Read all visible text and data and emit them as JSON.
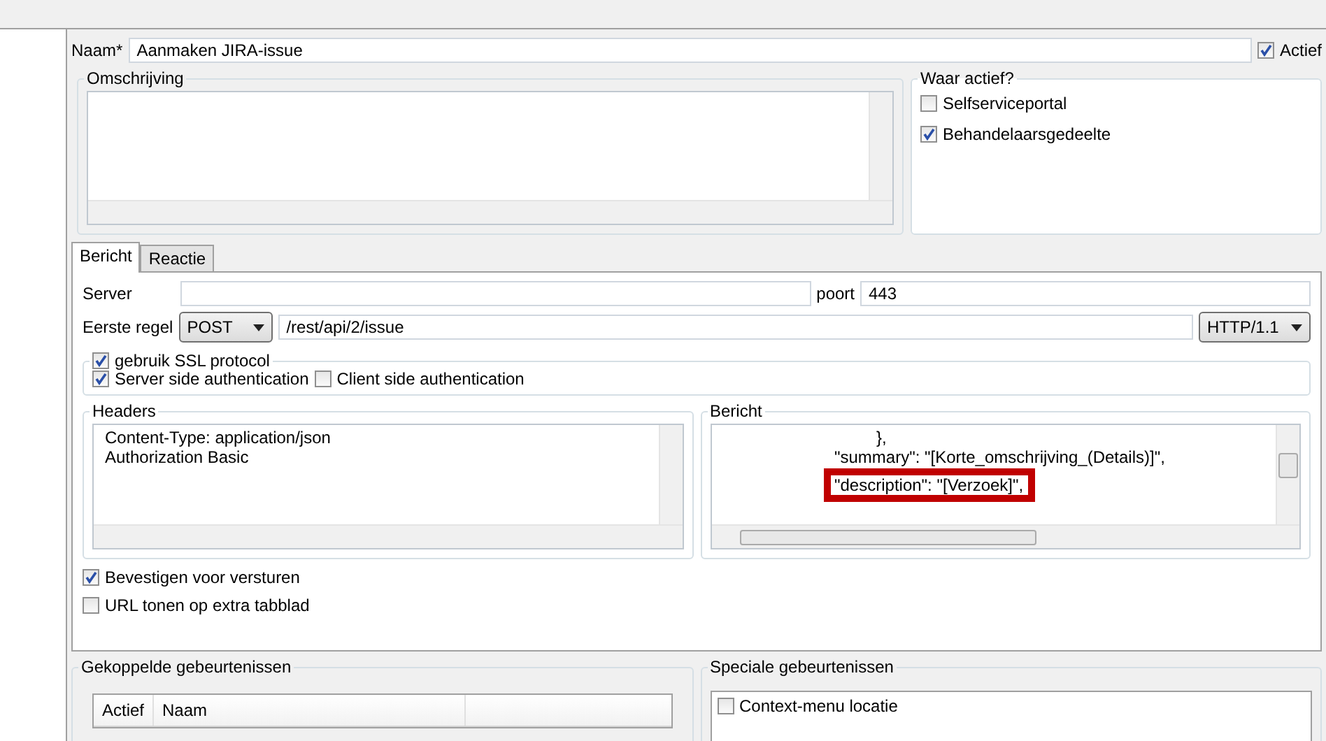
{
  "name_field": {
    "label": "Naam*",
    "value": "Aanmaken JIRA-issue"
  },
  "actief": {
    "label": "Actief",
    "checked": true
  },
  "omschrijving": {
    "title": "Omschrijving"
  },
  "waar_actief": {
    "title": "Waar actief?",
    "options": [
      {
        "label": "Selfserviceportal",
        "checked": false
      },
      {
        "label": "Behandelaarsgedeelte",
        "checked": true
      }
    ]
  },
  "tabs": [
    {
      "label": "Bericht",
      "selected": true
    },
    {
      "label": "Reactie",
      "selected": false
    }
  ],
  "server": {
    "label": "Server"
  },
  "poort": {
    "label": "poort",
    "value": "443"
  },
  "eerste_regel": {
    "label": "Eerste regel",
    "method": "POST",
    "path": "/rest/api/2/issue",
    "version": "HTTP/1.1"
  },
  "ssl": {
    "label": "gebruik SSL protocol",
    "checked": true,
    "options": [
      {
        "label": "Server side authentication",
        "checked": true
      },
      {
        "label": "Client side authentication",
        "checked": false
      }
    ]
  },
  "headers": {
    "title": "Headers",
    "lines": [
      "Content-Type: application/json",
      "Authorization Basic"
    ]
  },
  "bericht": {
    "title": "Bericht",
    "lines": [
      {
        "text": "},",
        "highlighted": false
      },
      {
        "text": "\"summary\": \"[Korte_omschrijving_(Details)]\",",
        "highlighted": false
      },
      {
        "text": "\"description\": \"[Verzoek]\",",
        "highlighted": true
      }
    ]
  },
  "options": [
    {
      "label": "Bevestigen voor versturen",
      "checked": true
    },
    {
      "label": "URL tonen op extra tabblad",
      "checked": false
    }
  ],
  "gekoppelde": {
    "title": "Gekoppelde gebeurtenissen",
    "columns": [
      "Actief",
      "Naam"
    ]
  },
  "speciale": {
    "title": "Speciale gebeurtenissen",
    "items": [
      {
        "label": "Context-menu locatie",
        "checked": false
      }
    ]
  }
}
